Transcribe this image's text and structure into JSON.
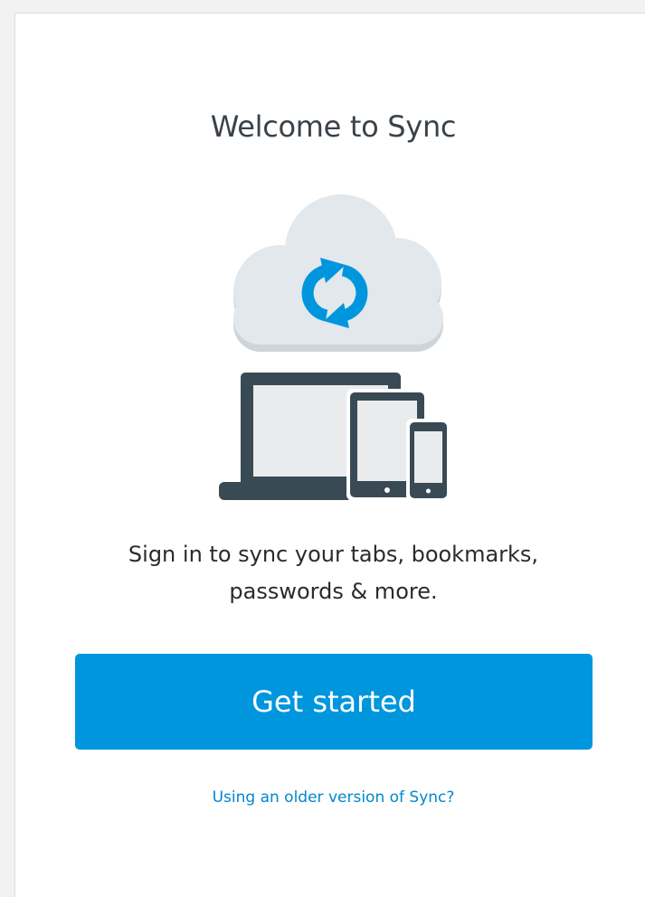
{
  "welcome": {
    "title": "Welcome to Sync",
    "description_line1": "Sign in to sync your tabs, bookmarks,",
    "description_line2": "passwords & more.",
    "get_started_label": "Get started",
    "older_version_link": "Using an older version of Sync?"
  },
  "illustration": {
    "cloud_icon": "cloud-icon",
    "sync_icon": "sync-arrows-icon",
    "laptop_icon": "laptop-icon",
    "tablet_icon": "tablet-icon",
    "phone_icon": "phone-icon"
  },
  "colors": {
    "accent": "#0096dd",
    "link": "#0087cc",
    "cloud": "#e3e8ec",
    "cloud_shadow": "#cdd4da",
    "device": "#3a4a55",
    "device_screen": "#e9ebed"
  }
}
